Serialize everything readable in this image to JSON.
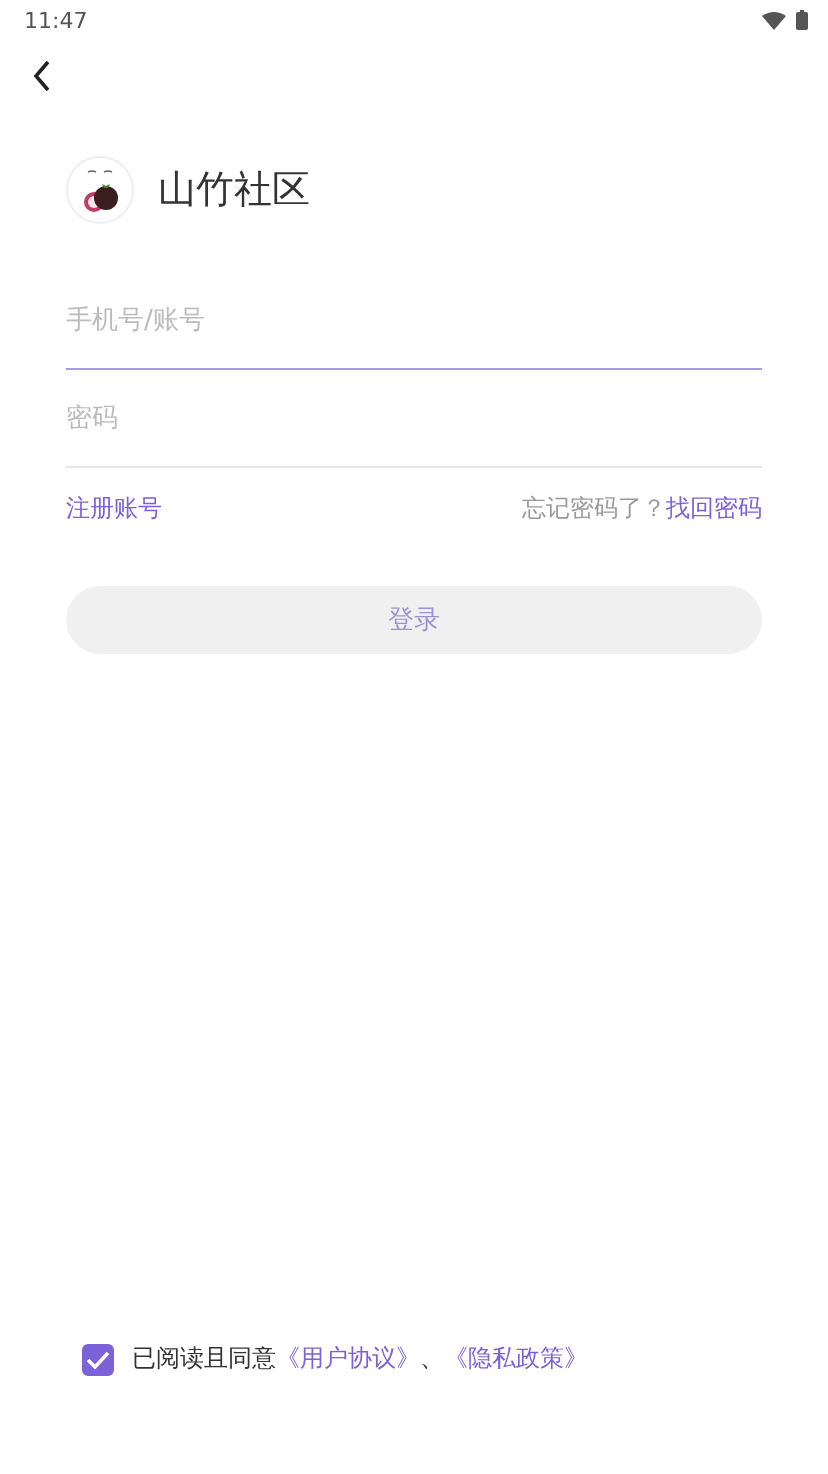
{
  "status_bar": {
    "time": "11:47"
  },
  "app": {
    "name": "山竹社区"
  },
  "fields": [
    {
      "placeholder": "手机号/账号",
      "focused": true
    },
    {
      "placeholder": "密码",
      "focused": false
    }
  ],
  "links": {
    "register": "注册账号",
    "forgot_prompt": "忘记密码了？",
    "recover": "找回密码"
  },
  "login_button": {
    "label": "登录",
    "disabled": true
  },
  "agreement": {
    "checked": true,
    "text": "已阅读且同意",
    "terms": "《用户协议》",
    "separator": "、",
    "privacy": "《隐私政策》"
  }
}
